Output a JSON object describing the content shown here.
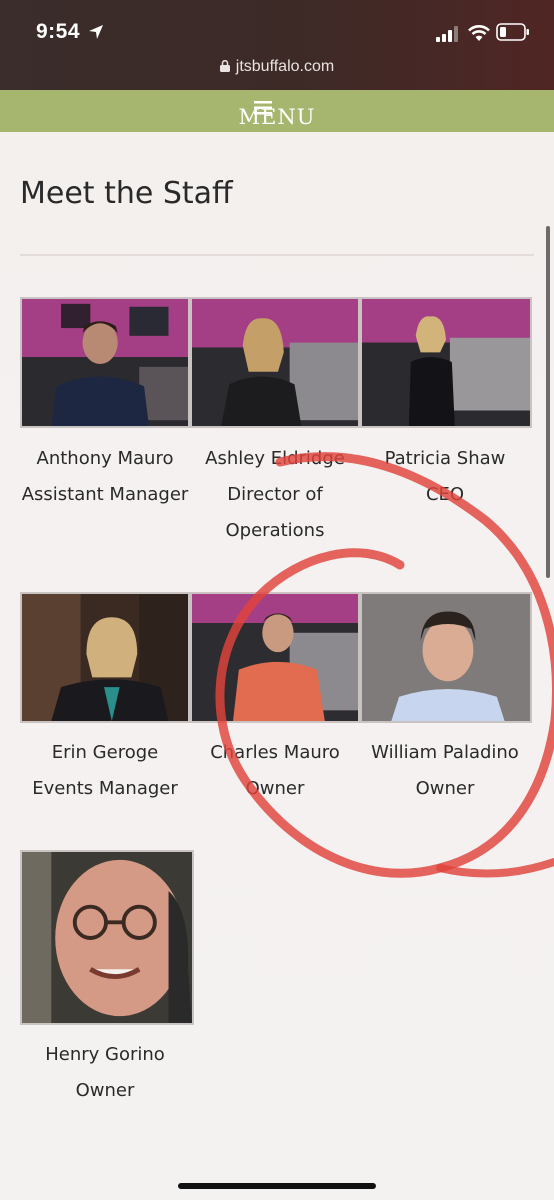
{
  "status_bar": {
    "time": "9:54",
    "icons": [
      "location-arrow-icon",
      "cellular-signal-icon",
      "wifi-icon",
      "battery-icon"
    ]
  },
  "browser": {
    "url": "jtsbuffalo.com"
  },
  "nav": {
    "menu_label": "MENU",
    "bar_color": "#a6b66f"
  },
  "page": {
    "title": "Meet the Staff"
  },
  "staff": [
    {
      "name": "Anthony Mauro",
      "role_lines": [
        "Assistant Manager"
      ]
    },
    {
      "name": "Ashley Eldridge",
      "role_lines": [
        "Director of",
        "Operations"
      ]
    },
    {
      "name": "Patricia Shaw",
      "role_lines": [
        "CEO"
      ]
    },
    {
      "name": "Erin Geroge",
      "role_lines": [
        "Events Manager"
      ]
    },
    {
      "name": "Charles Mauro",
      "role_lines": [
        "Owner"
      ]
    },
    {
      "name": "William Paladino",
      "role_lines": [
        "Owner"
      ]
    },
    {
      "name": "Henry Gorino",
      "role_lines": [
        "Owner"
      ]
    }
  ],
  "colors": {
    "annotation_stroke": "#e0433a",
    "restaurant_wall": "#a43f86"
  }
}
